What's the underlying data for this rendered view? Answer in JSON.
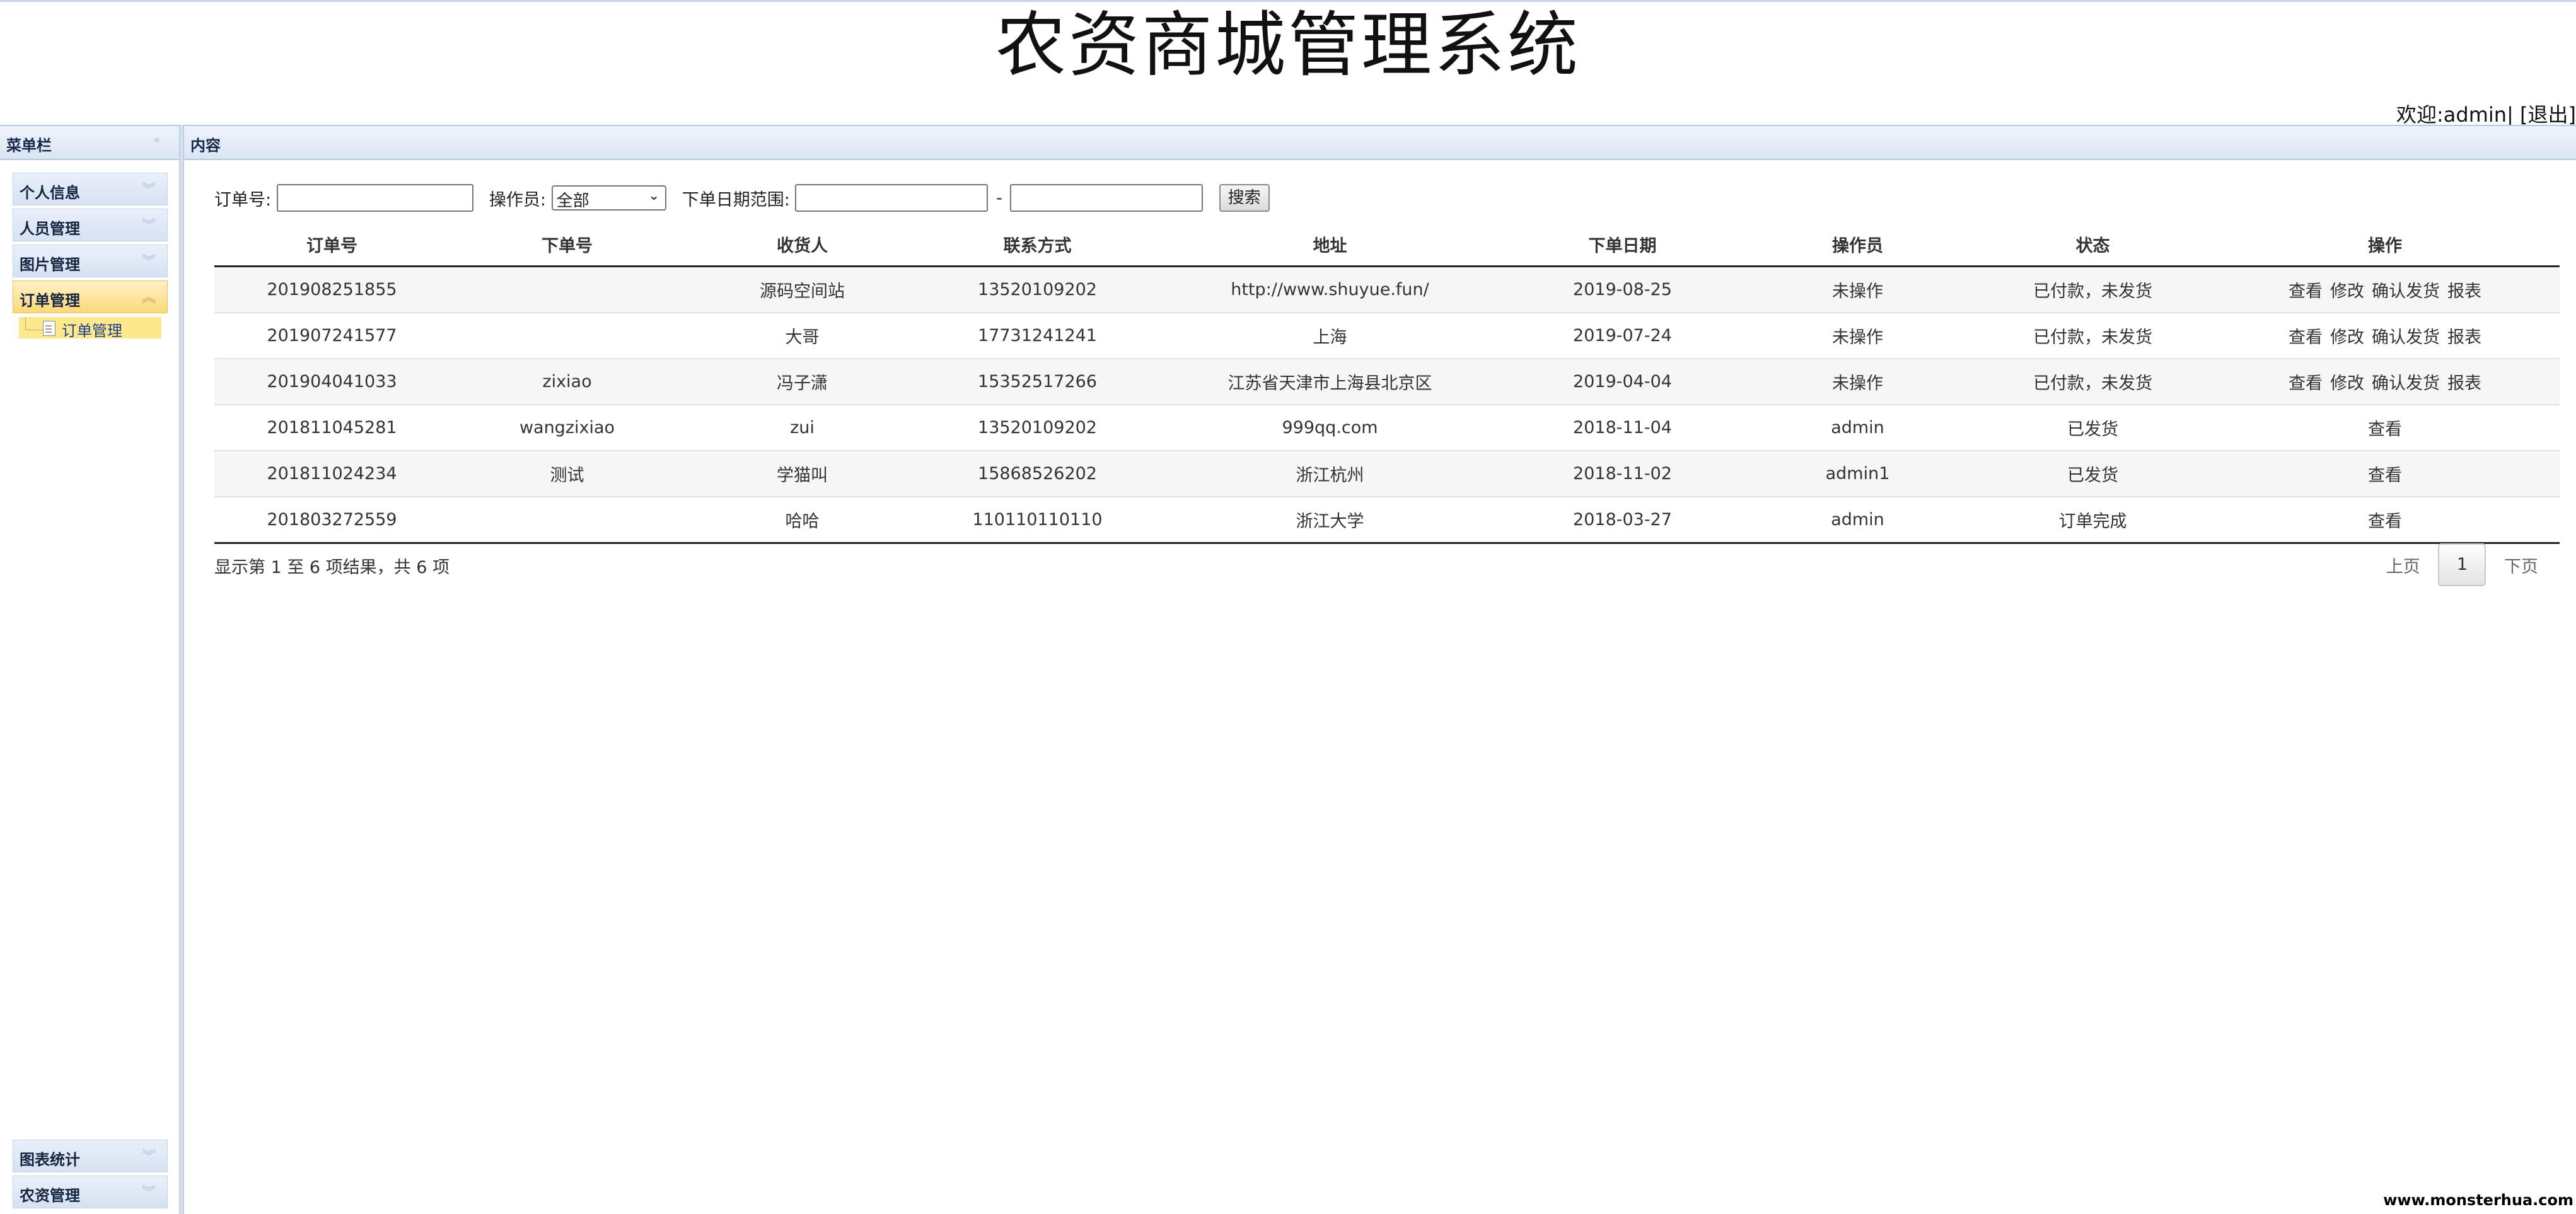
{
  "header": {
    "title": "农资商城管理系统",
    "welcome_prefix": "欢迎:",
    "username": "admin",
    "separator": "|",
    "logout": "[退出]"
  },
  "sidebar": {
    "title": "菜单栏",
    "menu": [
      {
        "label": "个人信息",
        "active": false
      },
      {
        "label": "人员管理",
        "active": false
      },
      {
        "label": "图片管理",
        "active": false
      },
      {
        "label": "订单管理",
        "active": true
      }
    ],
    "submenu": {
      "label": "订单管理"
    },
    "bottom_menu": [
      {
        "label": "图表统计"
      },
      {
        "label": "农资管理"
      }
    ]
  },
  "content": {
    "title": "内容",
    "filter": {
      "order_no_label": "订单号:",
      "operator_label": "操作员:",
      "operator_value": "全部",
      "date_range_label": "下单日期范围:",
      "date_sep": "-",
      "search_button": "搜索"
    },
    "table": {
      "columns": [
        "订单号",
        "下单号",
        "收货人",
        "联系方式",
        "地址",
        "下单日期",
        "操作员",
        "状态",
        "操作"
      ],
      "rows": [
        {
          "cells": [
            "201908251855",
            "",
            "源码空间站",
            "13520109202",
            "http://www.shuyue.fun/",
            "2019-08-25",
            "未操作",
            "已付款，未发货"
          ],
          "actions": [
            "查看",
            "修改",
            "确认发货",
            "报表"
          ]
        },
        {
          "cells": [
            "201907241577",
            "",
            "大哥",
            "17731241241",
            "上海",
            "2019-07-24",
            "未操作",
            "已付款，未发货"
          ],
          "actions": [
            "查看",
            "修改",
            "确认发货",
            "报表"
          ]
        },
        {
          "cells": [
            "201904041033",
            "zixiao",
            "冯子潇",
            "15352517266",
            "江苏省天津市上海县北京区",
            "2019-04-04",
            "未操作",
            "已付款，未发货"
          ],
          "actions": [
            "查看",
            "修改",
            "确认发货",
            "报表"
          ]
        },
        {
          "cells": [
            "201811045281",
            "wangzixiao",
            "zui",
            "13520109202",
            "999qq.com",
            "2018-11-04",
            "admin",
            "已发货"
          ],
          "actions": [
            "查看"
          ]
        },
        {
          "cells": [
            "201811024234",
            "测试",
            "学猫叫",
            "15868526202",
            "浙江杭州",
            "2018-11-02",
            "admin1",
            "已发货"
          ],
          "actions": [
            "查看"
          ]
        },
        {
          "cells": [
            "201803272559",
            "",
            "哈哈",
            "110110110110",
            "浙江大学",
            "2018-03-27",
            "admin",
            "订单完成"
          ],
          "actions": [
            "查看"
          ]
        }
      ]
    },
    "info": "显示第 1 至 6 项结果，共 6 项",
    "pager": {
      "prev": "上页",
      "current": "1",
      "next": "下页"
    }
  },
  "watermark": "www.monsterhua.com"
}
